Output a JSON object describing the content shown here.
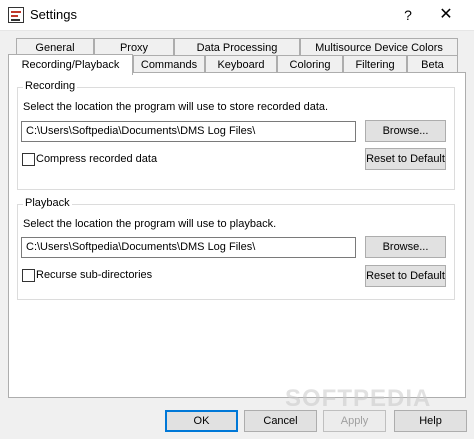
{
  "window": {
    "title": "Settings",
    "help_glyph": "?",
    "close_glyph": "✕"
  },
  "tabs_row1": [
    "General",
    "Proxy",
    "Data Processing",
    "Multisource Device Colors"
  ],
  "tabs_row2": [
    "Recording/Playback",
    "Commands",
    "Keyboard",
    "Coloring",
    "Filtering",
    "Beta"
  ],
  "recording": {
    "group_label": "Recording",
    "description": "Select the location the program will use to store recorded data.",
    "path_value": "C:\\Users\\Softpedia\\Documents\\DMS Log Files\\",
    "browse_label": "Browse...",
    "checkbox_label": "Compress recorded data",
    "reset_label": "Reset to Default"
  },
  "playback": {
    "group_label": "Playback",
    "description": "Select the location the program will use to playback.",
    "path_value": "C:\\Users\\Softpedia\\Documents\\DMS Log Files\\",
    "browse_label": "Browse...",
    "checkbox_label": "Recurse sub-directories",
    "reset_label": "Reset to Default"
  },
  "footer": {
    "ok": "OK",
    "cancel": "Cancel",
    "apply": "Apply",
    "help": "Help"
  },
  "watermark": "SOFTPEDIA"
}
